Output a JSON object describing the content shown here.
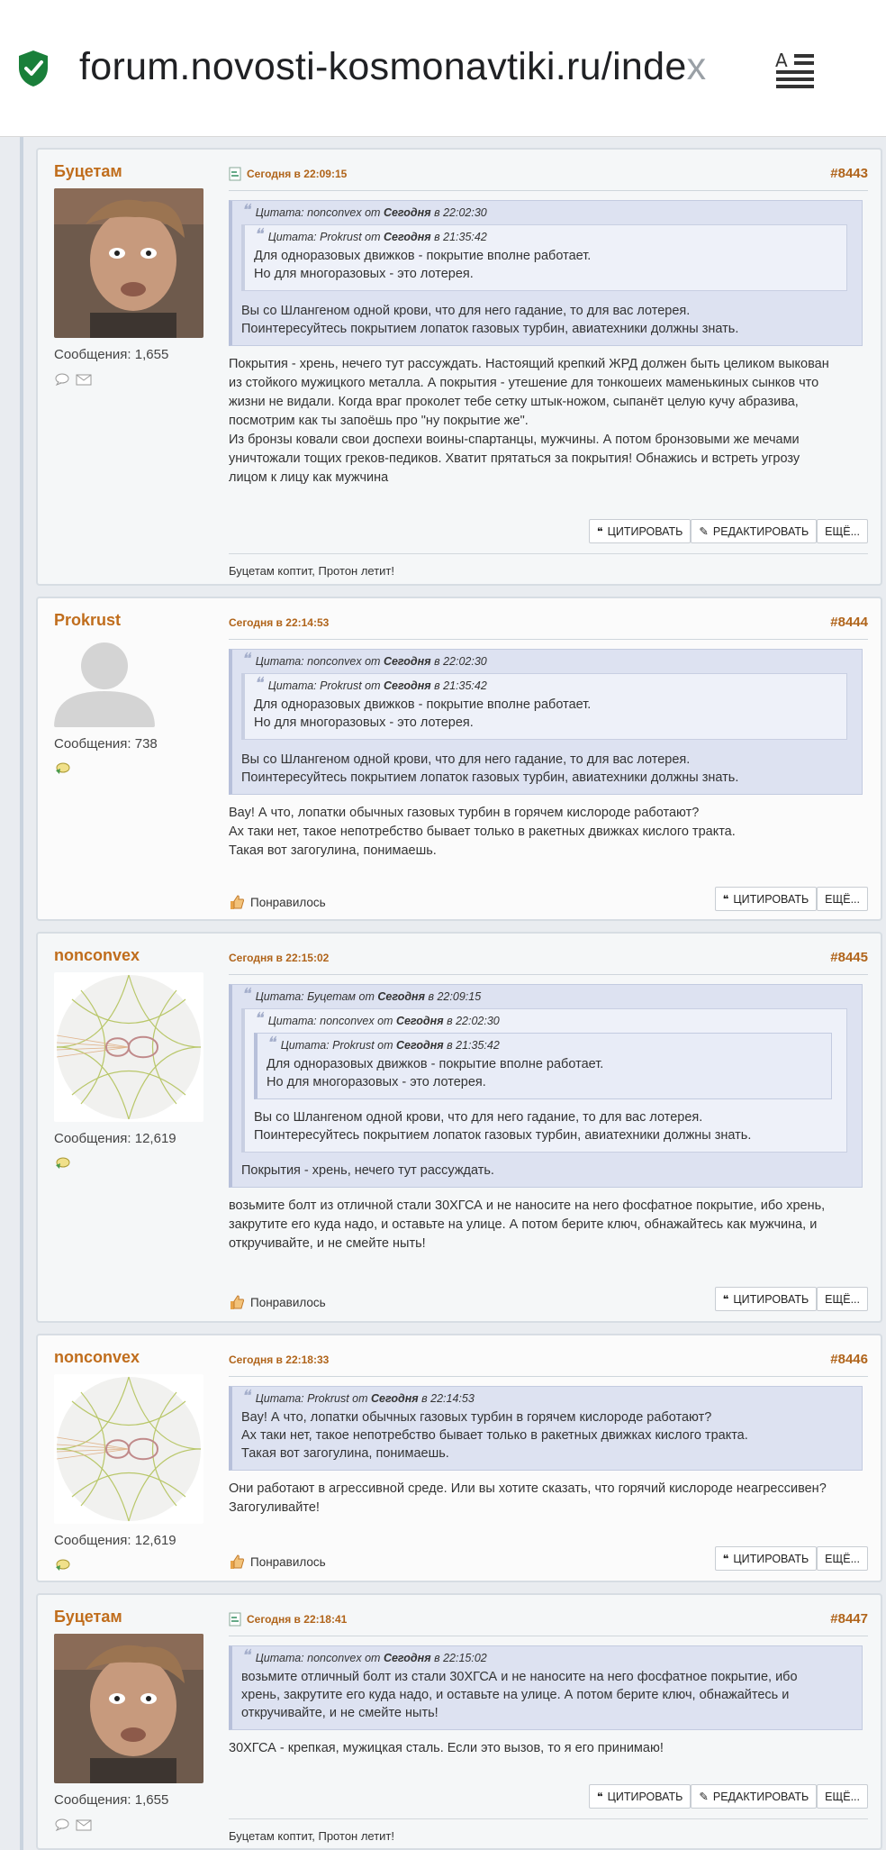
{
  "browser": {
    "url_main": "forum.novosti-kosmonavtiki.ru/inde",
    "url_fade": "x",
    "shield_color": "#1a7f3a"
  },
  "posts": [
    {
      "username": "Буцетам",
      "msgcount": "Сообщения: 1,655",
      "date": "Сегодня в 22:09:15",
      "number": "#8443",
      "quote": {
        "author": "nonconvex",
        "from_word": "от",
        "day": "Сегодня",
        "at_word": "в",
        "time": "22:02:30",
        "label": "Цитата:",
        "nested": {
          "label": "Цитата:",
          "author": "Prokrust",
          "from_word": "от",
          "day": "Сегодня",
          "at_word": "в",
          "time": "21:35:42",
          "lines": [
            "Для одноразовых движков - покрытие вполне работает.",
            "Но для многоразовых - это лотерея."
          ]
        },
        "lines": [
          "Вы со Шлангеном одной крови, что для него гадание, то для вас лотерея.",
          "Поинтересуйтесь покрытием лопаток газовых турбин, авиатехники должны знать."
        ]
      },
      "body": [
        "Покрытия - хрень, нечего тут рассуждать. Настоящий крепкий ЖРД должен быть целиком выкован",
        "из стойкого мужицкого металла. А покрытия - утешение для тонкошеих маменькиных сынков что",
        "жизни не видали. Когда враг проколет тебе сетку штык-ножом, сыпанёт целую кучу абразива,",
        "посмотрим как ты запоёшь про \"ну покрытие же\".",
        "Из бронзы ковали свои доспехи воины-спартанцы, мужчины. А потом бронзовыми же мечами",
        "уничтожали тощих греков-педиков. Хватит прятаться за покрытия! Обнажись и встреть угрозу",
        "лицом к лицу как мужчина"
      ],
      "buttons": [
        "ЦИТИРОВАТЬ",
        "РЕДАКТИРОВАТЬ",
        "ЕЩЁ..."
      ],
      "signature": "Буцетам коптит, Протон летит!"
    },
    {
      "username": "Prokrust",
      "msgcount": "Сообщения: 738",
      "date": "Сегодня в 22:14:53",
      "number": "#8444",
      "body": [
        "Вау! А что, лопатки обычных газовых турбин в горячем кислороде работают?",
        "Ах таки нет, такое непотребство бывает только в ракетных движках кислого тракта.",
        "Такая вот загогулина, понимаешь."
      ],
      "like": "Понравилось",
      "buttons": [
        "ЦИТИРОВАТЬ",
        "ЕЩЁ..."
      ]
    },
    {
      "username": "nonconvex",
      "msgcount": "Сообщения: 12,619",
      "date": "Сегодня в 22:15:02",
      "number": "#8445",
      "quote": {
        "label": "Цитата:",
        "author": "Буцетам",
        "from_word": "от",
        "day": "Сегодня",
        "at_word": "в",
        "time": "22:09:15",
        "lines": [
          "Покрытия - хрень, нечего тут рассуждать."
        ]
      },
      "body": [
        "возьмите болт из отличной стали 30ХГСА и не наносите на него фосфатное покрытие, ибо хрень,",
        "закрутите его куда надо, и оставьте на улице. А потом берите ключ, обнажайтесь как мужчина, и",
        "откручивайте, и не смейте ныть!"
      ],
      "like": "Понравилось",
      "buttons": [
        "ЦИТИРОВАТЬ",
        "ЕЩЁ..."
      ]
    },
    {
      "username": "nonconvex",
      "msgcount": "Сообщения: 12,619",
      "date": "Сегодня в 22:18:33",
      "number": "#8446",
      "quote": {
        "label": "Цитата:",
        "author": "Prokrust",
        "from_word": "от",
        "day": "Сегодня",
        "at_word": "в",
        "time": "22:14:53",
        "lines": [
          "Вау! А что, лопатки обычных газовых турбин в горячем кислороде работают?",
          "Ах таки нет, такое непотребство бывает только в ракетных движках кислого тракта.",
          "Такая вот загогулина, понимаешь."
        ]
      },
      "body": [
        "Они работают в агрессивной среде. Или вы хотите сказать, что горячий кислороде неагрессивен?",
        "Загогуливайте!"
      ],
      "like": "Понравилось",
      "buttons": [
        "ЦИТИРОВАТЬ",
        "ЕЩЁ..."
      ]
    },
    {
      "username": "Буцетам",
      "msgcount": "Сообщения: 1,655",
      "date": "Сегодня в 22:18:41",
      "number": "#8447",
      "quote": {
        "label": "Цитата:",
        "author": "nonconvex",
        "from_word": "от",
        "day": "Сегодня",
        "at_word": "в",
        "time": "22:15:02",
        "lines": [
          "возьмите отличный болт из стали 30ХГСА и не наносите на него фосфатное покрытие, ибо",
          "хрень, закрутите его куда надо, и оставьте на улице. А потом берите ключ, обнажайтесь и",
          "откручивайте, и не смейте ныть!"
        ]
      },
      "body": [
        "30ХГСА - крепкая, мужицкая сталь. Если это вызов, то я его принимаю!"
      ],
      "buttons": [
        "ЦИТИРОВАТЬ",
        "РЕДАКТИРОВАТЬ",
        "ЕЩЁ..."
      ],
      "signature": "Буцетам коптит, Протон летит!"
    }
  ],
  "colors": {
    "username": "#c06d1c",
    "quote_bg": "#dde2f1",
    "page_bg": "#e9ecf0"
  }
}
